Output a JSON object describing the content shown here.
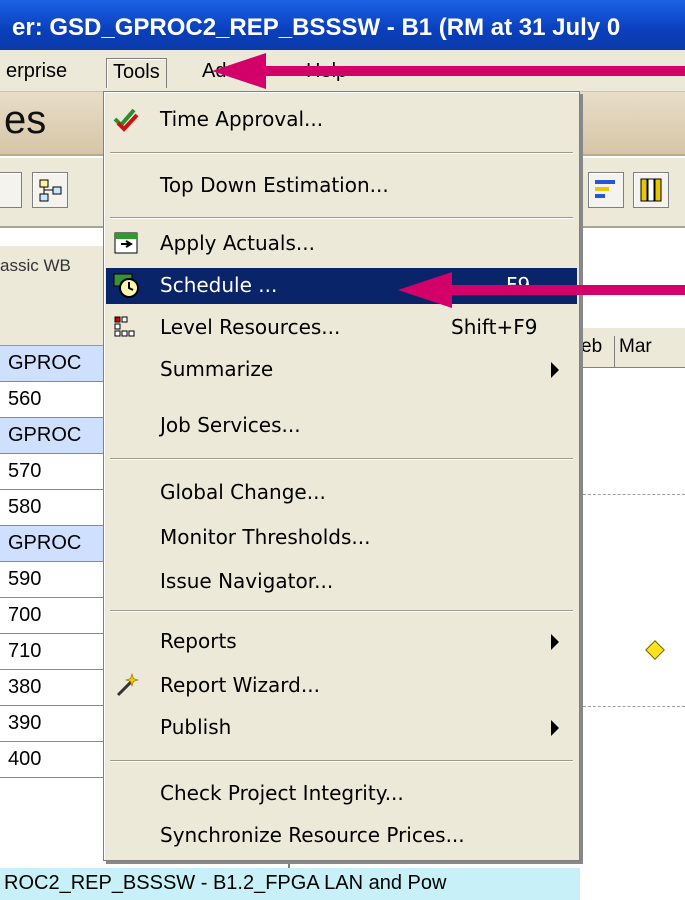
{
  "window": {
    "title": "er: GSD_GPROC2_REP_BSSSW - B1 (RM at 31 July 0"
  },
  "menubar": {
    "items": [
      {
        "label": "erprise"
      },
      {
        "label": "Tools"
      },
      {
        "label": "Ad"
      },
      {
        "label": "Help"
      }
    ]
  },
  "page": {
    "title": "es"
  },
  "subtab": {
    "label": "assic WB"
  },
  "gantt": {
    "header": [
      "eb",
      "Mar"
    ]
  },
  "rows": [
    "GPROC",
    "560",
    "GPROC",
    "570",
    "580",
    "GPROC",
    "590",
    "700",
    "710",
    "380",
    "390",
    "400"
  ],
  "bottom_row": {
    "text": "ROC2_REP_BSSSW - B1.2_FPGA LAN and Pow"
  },
  "tools_menu": {
    "items": [
      {
        "label": "Time Approval...",
        "icon": "checkmarks-icon"
      },
      {
        "label": "Top Down Estimation..."
      },
      {
        "label": "Apply Actuals...",
        "icon": "apply-actuals-icon"
      },
      {
        "label": "Schedule ...",
        "shortcut": "F9",
        "icon": "schedule-clock-icon",
        "selected": true
      },
      {
        "label": "Level Resources...",
        "shortcut": "Shift+F9",
        "icon": "level-resources-icon"
      },
      {
        "label": "Summarize",
        "submenu": true
      },
      {
        "label": "Job Services..."
      },
      {
        "label": "Global Change..."
      },
      {
        "label": "Monitor Thresholds..."
      },
      {
        "label": "Issue Navigator..."
      },
      {
        "label": "Reports",
        "submenu": true
      },
      {
        "label": "Report Wizard...",
        "icon": "magic-wand-icon"
      },
      {
        "label": "Publish",
        "submenu": true
      },
      {
        "label": "Check Project Integrity..."
      },
      {
        "label": "Synchronize Resource Prices..."
      }
    ]
  },
  "colors": {
    "selection": "#0a246a",
    "annotation_arrow": "#d4006a",
    "title_bar": "#0a3fbd"
  }
}
